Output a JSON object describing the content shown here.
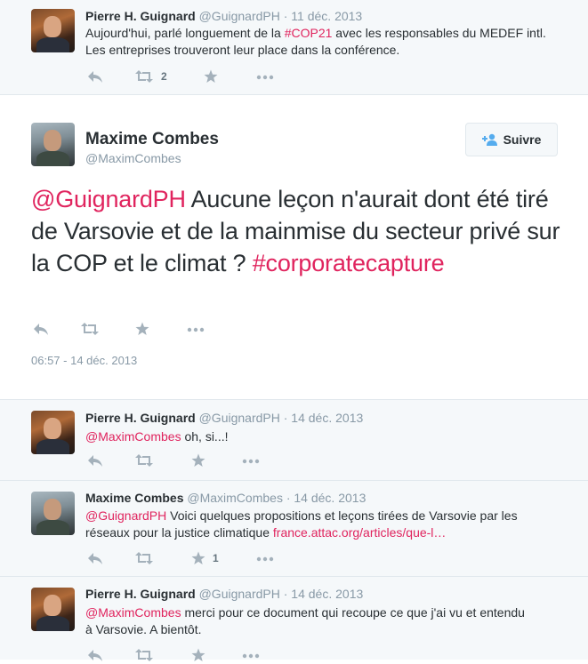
{
  "tweets": [
    {
      "author": "Pierre H. Guignard",
      "handle": "@GuignardPH",
      "date": "· 11 déc. 2013",
      "text_before": "Aujourd'hui, parlé longuement de la ",
      "hashtag": "#COP21",
      "text_after": " avec les responsables du MEDEF intl. Les entreprises trouveront leur place dans la conférence.",
      "retweets": "2"
    },
    {
      "author": "Maxime Combes",
      "handle": "@MaximCombes",
      "follow_label": "Suivre",
      "mention": "@GuignardPH",
      "text": " Aucune leçon n'aurait dont été tiré de Varsovie et de la mainmise du secteur privé sur la COP et le climat ? ",
      "hashtag": "#corporatecapture",
      "timestamp": "06:57 - 14 déc. 2013"
    },
    {
      "author": "Pierre H. Guignard",
      "handle": "@GuignardPH",
      "date": "· 14 déc. 2013",
      "mention": "@MaximCombes",
      "text": " oh, si...!"
    },
    {
      "author": "Maxime Combes",
      "handle": "@MaximCombes",
      "date": "· 14 déc. 2013",
      "mention": "@GuignardPH",
      "text": " Voici quelques propositions et leçons tirées de Varsovie par les réseaux pour la justice climatique ",
      "url": "france.attac.org/articles/que-l…",
      "favorites": "1"
    },
    {
      "author": "Pierre H. Guignard",
      "handle": "@GuignardPH",
      "date": "· 14 déc. 2013",
      "mention": "@MaximCombes",
      "text": " merci pour ce document qui recoupe ce que j'ai vu et entendu à Varsovie. A bientôt."
    }
  ],
  "icons": [
    "reply-icon",
    "retweet-icon",
    "favorite-icon",
    "more-icon",
    "follow-icon"
  ],
  "colors": {
    "link": "#e0245e",
    "meta": "#8899a6",
    "icon": "#a4b1bb",
    "accent": "#55acee"
  }
}
